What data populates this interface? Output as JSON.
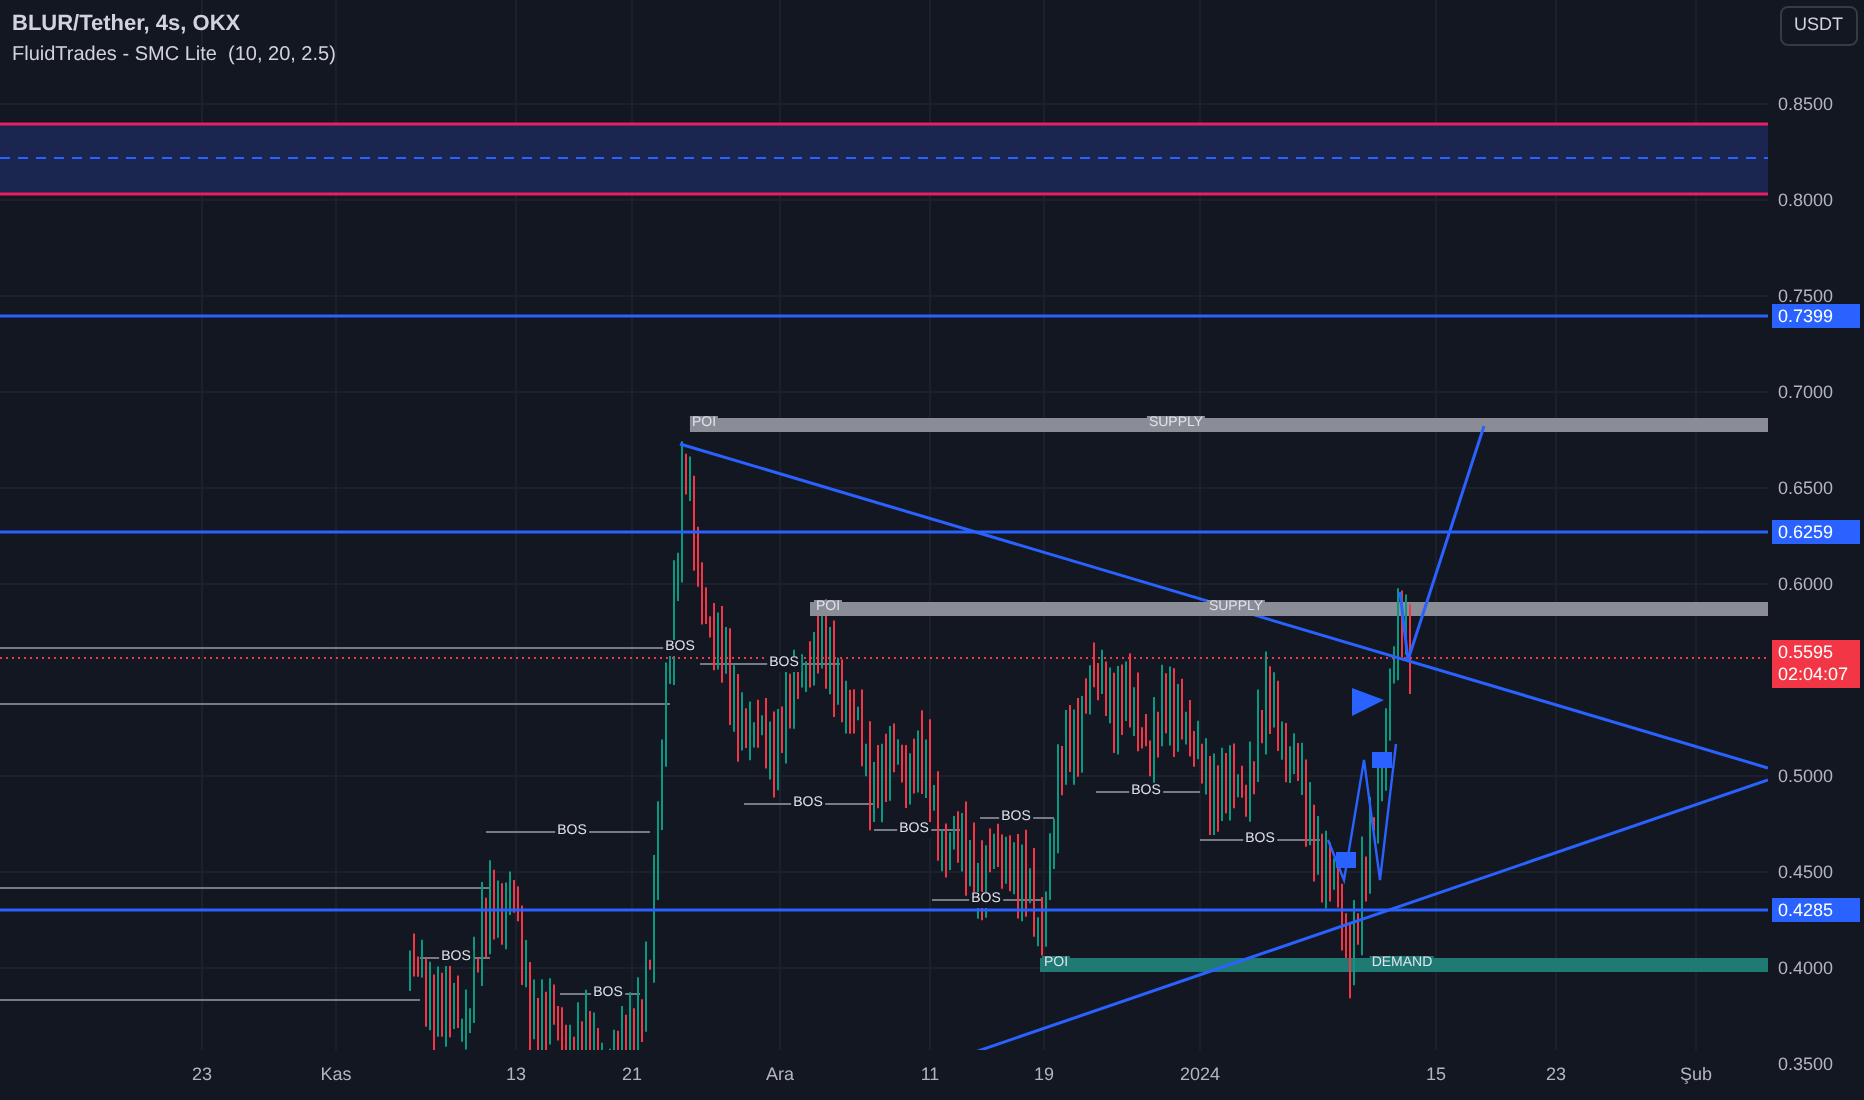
{
  "header": {
    "symbol": "BLUR/Tether, 4s, OKX",
    "indicator": "FluidTrades - SMC Lite  (10, 20, 2.5)"
  },
  "currency_button": "USDT",
  "price_axis": [
    "0.8500",
    "0.8000",
    "0.7500",
    "0.7000",
    "0.6500",
    "0.6000",
    "0.5000",
    "0.4500",
    "0.4000",
    "0.3500"
  ],
  "price_labels": [
    {
      "kind": "level",
      "text": "0.7399"
    },
    {
      "kind": "level",
      "text": "0.6259"
    },
    {
      "kind": "current",
      "text": "0.5595",
      "countdown": "02:04:07"
    },
    {
      "kind": "level",
      "text": "0.4285"
    }
  ],
  "annotations": [
    "POI",
    "SUPPLY",
    "POI",
    "SUPPLY",
    "BOS",
    "BOS",
    "BOS",
    "BOS",
    "BOS",
    "BOS",
    "BOS",
    "BOS",
    "BOS",
    "BOS",
    "BOS",
    "POI",
    "DEMAND"
  ],
  "time_axis": [
    "23",
    "Kas",
    "13",
    "21",
    "Ara",
    "11",
    "19",
    "2024",
    "15",
    "23",
    "Şub"
  ]
}
